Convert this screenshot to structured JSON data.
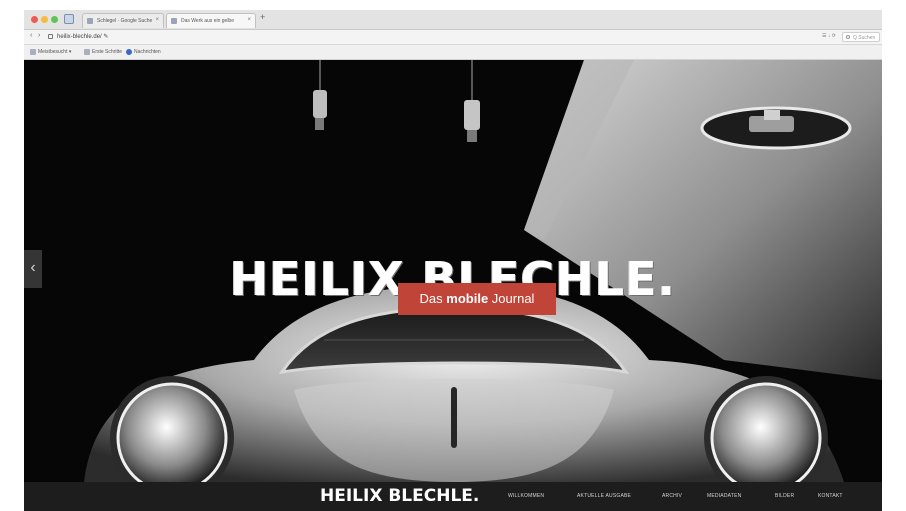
{
  "browser": {
    "tabs": [
      {
        "label": "Schlegel · Google Suche",
        "active": false
      },
      {
        "label": "Das Werk aus ein gelbe",
        "active": true
      }
    ],
    "new_tab_label": "+",
    "back_label": "‹",
    "forward_label": "›",
    "url": "heilix-blechle.de/ ✎",
    "toolbar_right": "☰ ↓ ⟳",
    "search_placeholder": "Q Suchen",
    "bookmarks": [
      {
        "label": "Meistbesucht ▾"
      },
      {
        "label": "Erste Schritte"
      },
      {
        "label": "Nachrichten"
      }
    ]
  },
  "hero": {
    "logo_text": "HEILIX BLECHLE.",
    "tagline_before": "Das ",
    "tagline_bold": "mobile",
    "tagline_after": " Journal",
    "prev_arrow": "‹",
    "accent_color": "#c14438"
  },
  "site_nav": {
    "logo_text": "HEILIX BLECHLE.",
    "items": [
      {
        "label": "WILLKOMMEN"
      },
      {
        "label": "AKTUELLE AUSGABE"
      },
      {
        "label": "ARCHIV"
      },
      {
        "label": "MEDIADATEN"
      },
      {
        "label": "BILDER"
      },
      {
        "label": "KONTAKT"
      }
    ]
  },
  "icons": {
    "close": "close-icon",
    "lock": "lock-icon",
    "search": "search-icon"
  }
}
